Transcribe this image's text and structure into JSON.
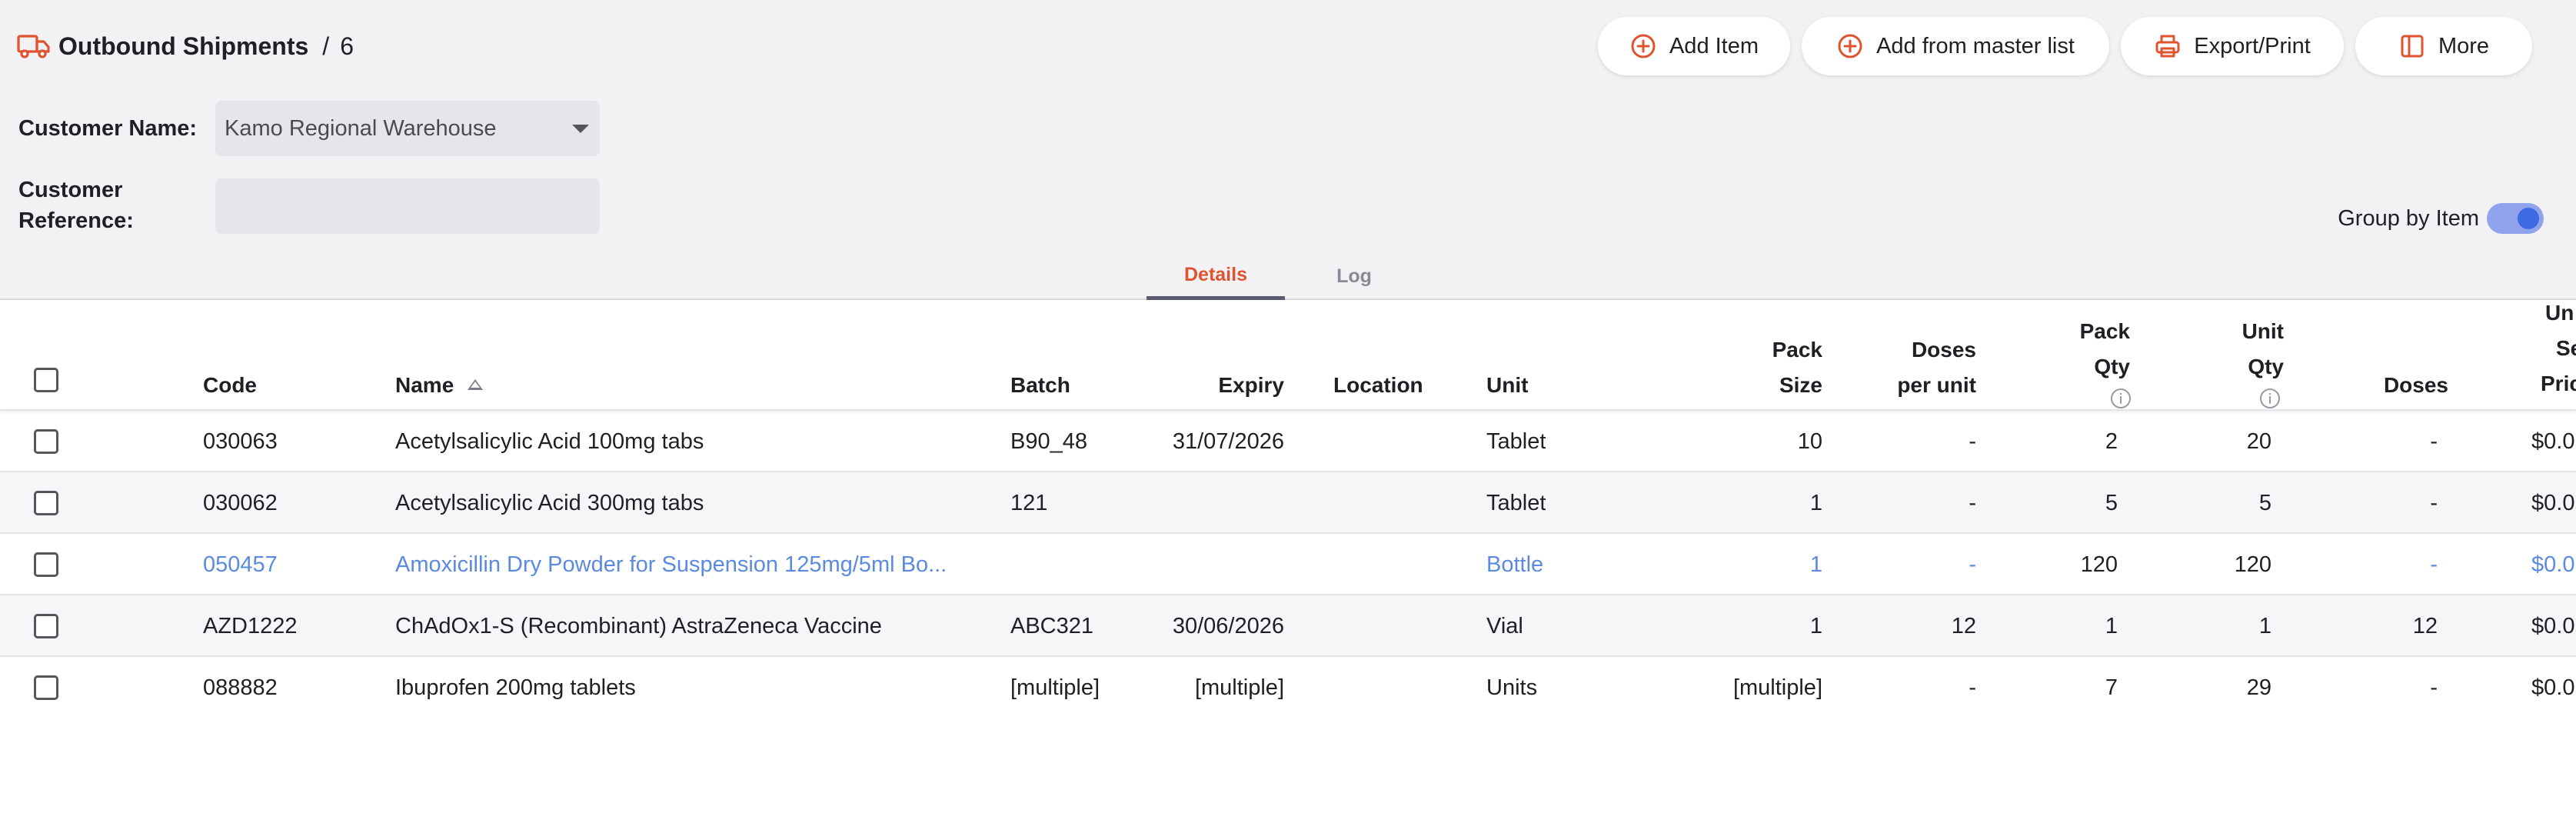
{
  "header": {
    "title": "Outbound Shipments",
    "separator": "/",
    "number": "6"
  },
  "actions": [
    {
      "label": "Add Item",
      "icon": "plus-circle-icon"
    },
    {
      "label": "Add from master list",
      "icon": "plus-circle-icon"
    },
    {
      "label": "Export/Print",
      "icon": "printer-icon"
    },
    {
      "label": "More",
      "icon": "sidebar-panel-icon"
    }
  ],
  "form": {
    "customer_name_label": "Customer Name:",
    "customer_name_value": "Kamo Regional Warehouse",
    "customer_reference_label_1": "Customer",
    "customer_reference_label_2": "Reference:",
    "customer_reference_value": ""
  },
  "group_by": {
    "label": "Group by Item",
    "enabled": true
  },
  "tabs": [
    {
      "label": "Details",
      "active": true
    },
    {
      "label": "Log",
      "active": false
    }
  ],
  "columns": {
    "code": "Code",
    "name": "Name",
    "batch": "Batch",
    "expiry": "Expiry",
    "location": "Location",
    "unit": "Unit",
    "pack_size_1": "Pack",
    "pack_size_2": "Size",
    "doses_per_unit_1": "Doses",
    "doses_per_unit_2": "per unit",
    "pack_qty_1": "Pack",
    "pack_qty_2": "Qty",
    "unit_qty_1": "Unit",
    "unit_qty_2": "Qty",
    "doses": "Doses",
    "unit_sell_price_1": "Un",
    "unit_sell_price_2": "Se",
    "unit_sell_price_3": "Pric"
  },
  "rows": [
    {
      "code": "030063",
      "name": "Acetylsalicylic Acid 100mg tabs",
      "batch": "B90_48",
      "expiry": "31/07/2026",
      "location": "",
      "unit": "Tablet",
      "pack_size": "10",
      "doses_per_unit": "-",
      "pack_qty": "2",
      "unit_qty": "20",
      "doses": "-",
      "price": "$0.0",
      "linked": false
    },
    {
      "code": "030062",
      "name": "Acetylsalicylic Acid 300mg tabs",
      "batch": "121",
      "expiry": "",
      "location": "",
      "unit": "Tablet",
      "pack_size": "1",
      "doses_per_unit": "-",
      "pack_qty": "5",
      "unit_qty": "5",
      "doses": "-",
      "price": "$0.0",
      "linked": false
    },
    {
      "code": "050457",
      "name": "Amoxicillin Dry Powder for Suspension 125mg/5ml Bo...",
      "batch": "",
      "expiry": "",
      "location": "",
      "unit": "Bottle",
      "pack_size": "1",
      "doses_per_unit": "-",
      "pack_qty": "120",
      "unit_qty": "120",
      "doses": "-",
      "price": "$0.0",
      "linked": true
    },
    {
      "code": "AZD1222",
      "name": "ChAdOx1-S (Recombinant) AstraZeneca Vaccine",
      "batch": "ABC321",
      "expiry": "30/06/2026",
      "location": "",
      "unit": "Vial",
      "pack_size": "1",
      "doses_per_unit": "12",
      "pack_qty": "1",
      "unit_qty": "1",
      "doses": "12",
      "price": "$0.0",
      "linked": false
    },
    {
      "code": "088882",
      "name": "Ibuprofen 200mg tablets",
      "batch": "[multiple]",
      "expiry": "[multiple]",
      "location": "",
      "unit": "Units",
      "pack_size": "[multiple]",
      "doses_per_unit": "-",
      "pack_qty": "7",
      "unit_qty": "29",
      "doses": "-",
      "price": "$0.0",
      "linked": false
    }
  ],
  "colors": {
    "accent": "#e0532f",
    "link": "#5b8ae0",
    "toggle_track": "#8fa3ec",
    "toggle_knob": "#3d6ae0",
    "background": "#f2f2f5"
  }
}
